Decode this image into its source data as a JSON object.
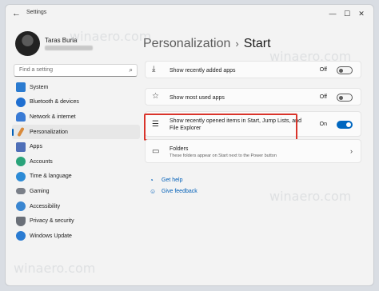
{
  "window": {
    "title": "Settings",
    "minimize_glyph": "—",
    "maximize_glyph": "☐",
    "close_glyph": "✕",
    "back_glyph": "←"
  },
  "user": {
    "name": "Taras Buria"
  },
  "search": {
    "placeholder": "Find a setting",
    "icon": "search-icon"
  },
  "sidebar": {
    "items": [
      {
        "label": "System",
        "icon": "monitor-icon",
        "color": "#2b7bd0"
      },
      {
        "label": "Bluetooth & devices",
        "icon": "bluetooth-icon",
        "color": "#1f6fd1"
      },
      {
        "label": "Network & internet",
        "icon": "wifi-icon",
        "color": "#3a7bd5"
      },
      {
        "label": "Personalization",
        "icon": "brush-icon",
        "color": "#d98a3b",
        "active": true
      },
      {
        "label": "Apps",
        "icon": "apps-icon",
        "color": "#4f6fb8"
      },
      {
        "label": "Accounts",
        "icon": "person-icon",
        "color": "#2aa37a"
      },
      {
        "label": "Time & language",
        "icon": "globe-clock-icon",
        "color": "#2d8bd6"
      },
      {
        "label": "Gaming",
        "icon": "gamepad-icon",
        "color": "#7a7f88"
      },
      {
        "label": "Accessibility",
        "icon": "accessibility-icon",
        "color": "#3a86d1"
      },
      {
        "label": "Privacy & security",
        "icon": "shield-icon",
        "color": "#6a6f78"
      },
      {
        "label": "Windows Update",
        "icon": "update-icon",
        "color": "#2a7bd2"
      }
    ]
  },
  "breadcrumb": {
    "parent": "Personalization",
    "separator": "›",
    "current": "Start"
  },
  "settings": [
    {
      "label": "Show recently added apps",
      "state": "Off",
      "on": false,
      "icon": "download-icon"
    },
    {
      "label": "Show most used apps",
      "state": "Off",
      "on": false,
      "icon": "star-icon"
    },
    {
      "label_line1": "Show recently opened items in Start, Jump Lists, and",
      "label_line2": "File Explorer",
      "state": "On",
      "on": true,
      "icon": "list-icon"
    }
  ],
  "folders": {
    "label": "Folders",
    "sublabel": "These folders appear on Start next to the Power button",
    "icon": "folder-icon",
    "chevron": "›"
  },
  "links": {
    "help": "Get help",
    "feedback": "Give feedback"
  },
  "watermark": "winaero.com",
  "colors": {
    "accent": "#005fb8",
    "highlight": "#d9342b",
    "toggle_on": "#0067c0"
  }
}
